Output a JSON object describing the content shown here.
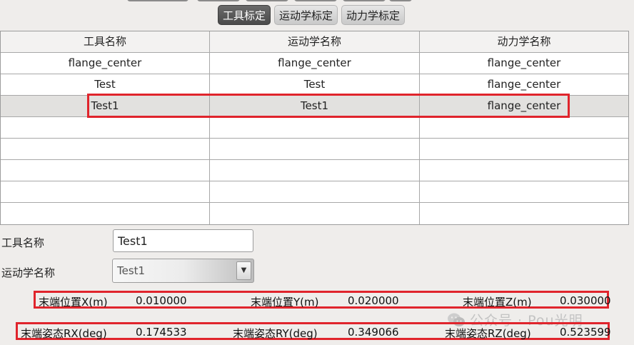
{
  "tabs": [
    {
      "label": "工具标定",
      "active": true
    },
    {
      "label": "运动学标定",
      "active": false
    },
    {
      "label": "动力学标定",
      "active": false
    }
  ],
  "table": {
    "headers": [
      "工具名称",
      "运动学名称",
      "动力学名称"
    ],
    "rows": [
      [
        "flange_center",
        "flange_center",
        "flange_center"
      ],
      [
        "Test",
        "Test",
        "flange_center"
      ],
      [
        "Test1",
        "Test1",
        "flange_center"
      ]
    ],
    "selected_row": 2,
    "empty_rows": 5
  },
  "form": {
    "tool_name_label": "工具名称",
    "tool_name_value": "Test1",
    "kinematics_label": "运动学名称",
    "kinematics_value": "Test1"
  },
  "pose": {
    "x_label": "末端位置X(m)",
    "x_value": "0.010000",
    "y_label": "末端位置Y(m)",
    "y_value": "0.020000",
    "z_label": "末端位置Z(m)",
    "z_value": "0.030000",
    "rx_label": "末端姿态RX(deg)",
    "rx_value": "0.174533",
    "ry_label": "末端姿态RY(deg)",
    "ry_value": "0.349066",
    "rz_label": "末端姿态RZ(deg)",
    "rz_value": "0.523599"
  },
  "watermark": {
    "text": "公众号 · Pou光明",
    "icon": "wechat-icon"
  },
  "colors": {
    "highlight": "#e0242c",
    "active_tab": "#555555"
  }
}
